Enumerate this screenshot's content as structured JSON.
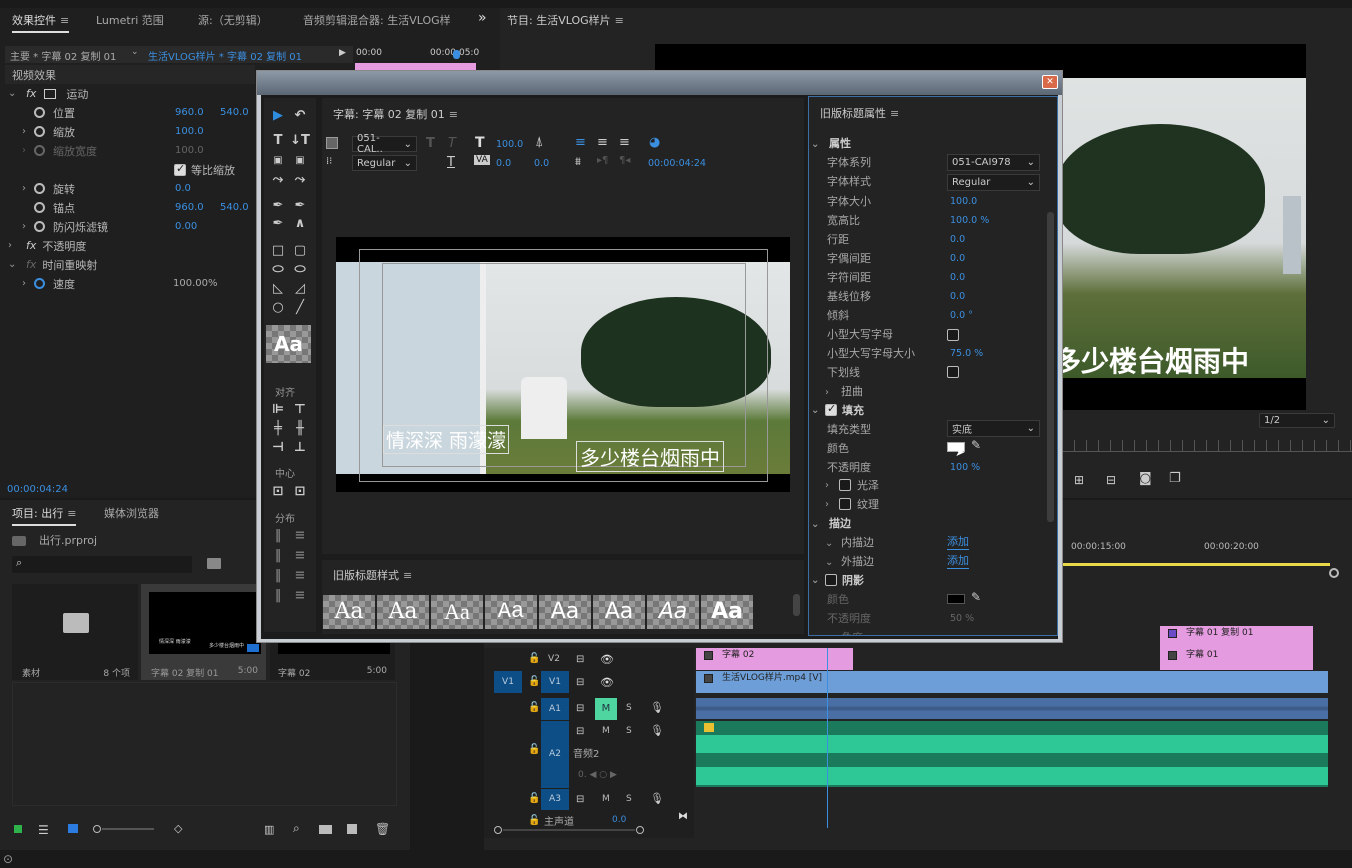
{
  "top_tabs": {
    "effects": "效果控件",
    "lumetri": "Lumetri 范围",
    "source": "源:（无剪辑）",
    "audio_mixer": "音频剪辑混合器: 生活VLOG样",
    "overflow": "»"
  },
  "program_title": "节目: 生活VLOG样片",
  "effects": {
    "master": "主要 * 字幕 02 复制 01",
    "clip": "生活VLOG样片 * 字幕 02 复制 01",
    "mini_timecodes": [
      "00:00",
      "00:00:05:0"
    ],
    "video_effects": "视频效果",
    "motion": "运动",
    "props": [
      {
        "label": "位置",
        "v1": "960.0",
        "v2": "540.0"
      },
      {
        "label": "缩放",
        "v1": "100.0"
      },
      {
        "label": "缩放宽度",
        "v1": "100.0"
      },
      {
        "label": "旋转",
        "v1": "0.0"
      },
      {
        "label": "锚点",
        "v1": "960.0",
        "v2": "540.0"
      },
      {
        "label": "防闪烁滤镜",
        "v1": "0.00"
      }
    ],
    "uniform_scale": "等比缩放",
    "opacity": "不透明度",
    "time_remap": "时间重映射",
    "speed": {
      "label": "速度",
      "value": "100.00%"
    },
    "timecode": "00:00:04:24"
  },
  "project": {
    "tab": "项目: 出行",
    "media_browser": "媒体浏览器",
    "file": "出行.prproj",
    "search_placeholder": "",
    "items": [
      {
        "name": "素材",
        "meta": "8 个项"
      },
      {
        "name": "字幕 02 复制 01",
        "meta": "5:00",
        "thumb_l": "情深深 雨濛濛",
        "thumb_r": "多少楼台烟雨中"
      },
      {
        "name": "字幕 02",
        "meta": "5:00"
      }
    ]
  },
  "title_window": {
    "title": "字幕: 字幕 02 复制 01",
    "font": "051-CAL..",
    "style": "Regular",
    "size": "100.0",
    "kerning": "0.0",
    "tracking": "0.0",
    "timecode": "00:00:04:24",
    "subtitle_left": "情深深 雨濛濛",
    "subtitle_right": "多少楼台烟雨中",
    "align_label": "对齐",
    "center_label": "中心",
    "distribute_label": "分布",
    "aa": "Aa",
    "styles_title": "旧版标题样式",
    "styles": [
      "Aa",
      "Aa",
      "Aa",
      "Aa",
      "Aa",
      "Aa",
      "Aa",
      "Aa"
    ]
  },
  "properties": {
    "title": "旧版标题属性",
    "section": "属性",
    "rows": [
      {
        "label": "字体系列",
        "value": "051-CAI978",
        "type": "select"
      },
      {
        "label": "字体样式",
        "value": "Regular",
        "type": "select"
      },
      {
        "label": "字体大小",
        "value": "100.0"
      },
      {
        "label": "宽高比",
        "value": "100.0 %"
      },
      {
        "label": "行距",
        "value": "0.0"
      },
      {
        "label": "字偶间距",
        "value": "0.0"
      },
      {
        "label": "字符间距",
        "value": "0.0"
      },
      {
        "label": "基线位移",
        "value": "0.0"
      },
      {
        "label": "倾斜",
        "value": "0.0 °"
      },
      {
        "label": "小型大写字母",
        "value": "",
        "type": "checkbox"
      },
      {
        "label": "小型大写字母大小",
        "value": "75.0 %"
      },
      {
        "label": "下划线",
        "value": "",
        "type": "checkbox"
      }
    ],
    "distort": "扭曲",
    "fill": "填充",
    "fill_type_label": "填充类型",
    "fill_type": "实底",
    "color": "颜色",
    "opacity": "不透明度",
    "opacity_value": "100 %",
    "sheen": "光泽",
    "texture": "纹理",
    "strokes": "描边",
    "inner": "内描边",
    "outer": "外描边",
    "add": "添加",
    "shadow": "阴影",
    "shadow_color": "颜色",
    "shadow_opacity": "不透明度",
    "shadow_opacity_value": "50 %",
    "angle": "角度"
  },
  "monitor": {
    "caption": "多少楼台烟雨中",
    "zoom": "1/2"
  },
  "timeline": {
    "times": [
      "00:00:15:00",
      "00:00:20:00"
    ],
    "tracks": {
      "v2": "V2",
      "v1": "V1",
      "a1": "A1",
      "a2": "A2",
      "a3": "A3",
      "a2_name": "音频2",
      "master": "主声道",
      "master_val": "0.0",
      "m": "M",
      "s": "S"
    },
    "clips": {
      "sub02": "字幕 02",
      "vlog": "生活VLOG样片.mp4 [V]",
      "sub01copy": "字幕 01 复制 01",
      "sub01": "字幕 01"
    }
  }
}
